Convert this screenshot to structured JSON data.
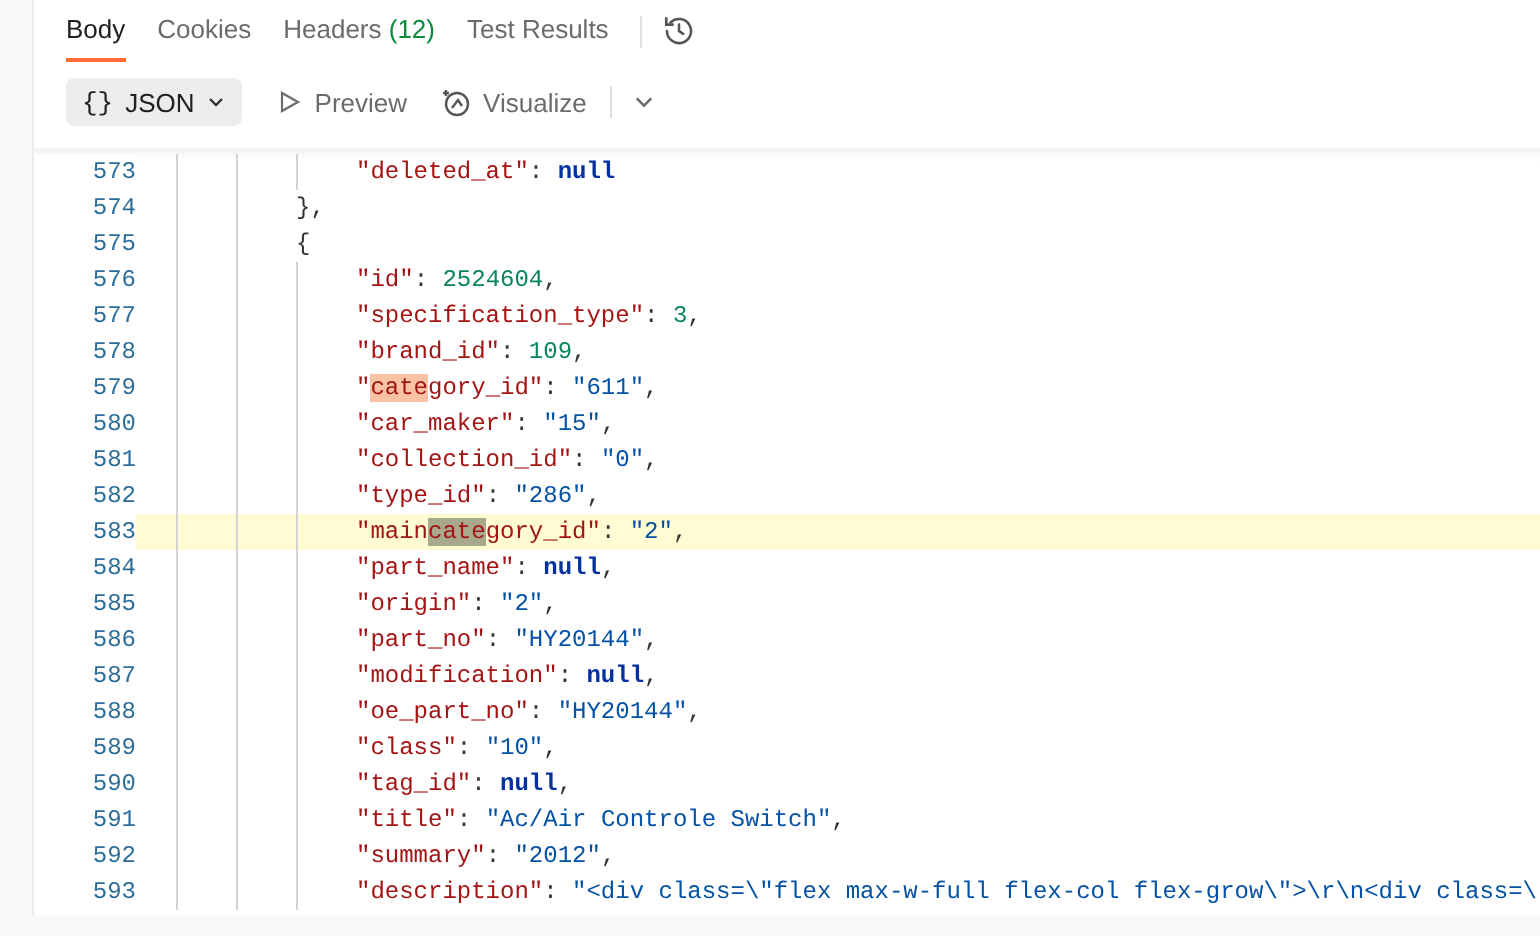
{
  "tabs": [
    {
      "label": "Body",
      "selected": true
    },
    {
      "label": "Cookies",
      "selected": false
    },
    {
      "label": "Headers",
      "count": "(12)",
      "selected": false
    },
    {
      "label": "Test Results",
      "selected": false
    }
  ],
  "toolbar": {
    "format_icon": "{}",
    "format": "JSON",
    "preview": "Preview",
    "visualize": "Visualize"
  },
  "lines": [
    {
      "number": "573",
      "kind": "member",
      "selected": false,
      "tokens": [
        {
          "kind": "key",
          "text": "\"deleted_at\""
        },
        {
          "kind": "punct",
          "text": ": "
        },
        {
          "kind": "null",
          "text": "null"
        }
      ]
    },
    {
      "number": "574",
      "kind": "bracket",
      "selected": false,
      "tokens": [
        {
          "kind": "punct",
          "text": "},"
        }
      ]
    },
    {
      "number": "575",
      "kind": "bracket",
      "selected": false,
      "tokens": [
        {
          "kind": "punct",
          "text": "{"
        }
      ]
    },
    {
      "number": "576",
      "kind": "member",
      "selected": false,
      "tokens": [
        {
          "kind": "key",
          "text": "\"id\""
        },
        {
          "kind": "punct",
          "text": ": "
        },
        {
          "kind": "number",
          "text": "2524604"
        },
        {
          "kind": "punct",
          "text": ","
        }
      ]
    },
    {
      "number": "577",
      "kind": "member",
      "selected": false,
      "tokens": [
        {
          "kind": "key",
          "text": "\"specification_type\""
        },
        {
          "kind": "punct",
          "text": ": "
        },
        {
          "kind": "number",
          "text": "3"
        },
        {
          "kind": "punct",
          "text": ","
        }
      ]
    },
    {
      "number": "578",
      "kind": "member",
      "selected": false,
      "tokens": [
        {
          "kind": "key",
          "text": "\"brand_id\""
        },
        {
          "kind": "punct",
          "text": ": "
        },
        {
          "kind": "number",
          "text": "109"
        },
        {
          "kind": "punct",
          "text": ","
        }
      ]
    },
    {
      "number": "579",
      "kind": "member",
      "selected": false,
      "tokens": [
        {
          "kind": "key",
          "text": "\""
        },
        {
          "kind": "key-match",
          "text": "cate",
          "selected": true
        },
        {
          "kind": "key",
          "text": "gory_id\""
        },
        {
          "kind": "punct",
          "text": ": "
        },
        {
          "kind": "string",
          "text": "\"611\""
        },
        {
          "kind": "punct",
          "text": ","
        }
      ]
    },
    {
      "number": "580",
      "kind": "member",
      "selected": false,
      "tokens": [
        {
          "kind": "key",
          "text": "\"car_maker\""
        },
        {
          "kind": "punct",
          "text": ": "
        },
        {
          "kind": "string",
          "text": "\"15\""
        },
        {
          "kind": "punct",
          "text": ","
        }
      ]
    },
    {
      "number": "581",
      "kind": "member",
      "selected": false,
      "tokens": [
        {
          "kind": "key",
          "text": "\"collection_id\""
        },
        {
          "kind": "punct",
          "text": ": "
        },
        {
          "kind": "string",
          "text": "\"0\""
        },
        {
          "kind": "punct",
          "text": ","
        }
      ]
    },
    {
      "number": "582",
      "kind": "member",
      "selected": false,
      "tokens": [
        {
          "kind": "key",
          "text": "\"type_id\""
        },
        {
          "kind": "punct",
          "text": ": "
        },
        {
          "kind": "string",
          "text": "\"286\""
        },
        {
          "kind": "punct",
          "text": ","
        }
      ]
    },
    {
      "number": "583",
      "kind": "member",
      "selected": true,
      "tokens": [
        {
          "kind": "key",
          "text": "\"main"
        },
        {
          "kind": "key-match",
          "text": "cate",
          "selected": false
        },
        {
          "kind": "key",
          "text": "gory_id\""
        },
        {
          "kind": "punct",
          "text": ": "
        },
        {
          "kind": "string",
          "text": "\"2\""
        },
        {
          "kind": "punct",
          "text": ","
        }
      ]
    },
    {
      "number": "584",
      "kind": "member",
      "selected": false,
      "tokens": [
        {
          "kind": "key",
          "text": "\"part_name\""
        },
        {
          "kind": "punct",
          "text": ": "
        },
        {
          "kind": "null",
          "text": "null"
        },
        {
          "kind": "punct",
          "text": ","
        }
      ]
    },
    {
      "number": "585",
      "kind": "member",
      "selected": false,
      "tokens": [
        {
          "kind": "key",
          "text": "\"origin\""
        },
        {
          "kind": "punct",
          "text": ": "
        },
        {
          "kind": "string",
          "text": "\"2\""
        },
        {
          "kind": "punct",
          "text": ","
        }
      ]
    },
    {
      "number": "586",
      "kind": "member",
      "selected": false,
      "tokens": [
        {
          "kind": "key",
          "text": "\"part_no\""
        },
        {
          "kind": "punct",
          "text": ": "
        },
        {
          "kind": "string",
          "text": "\"HY20144\""
        },
        {
          "kind": "punct",
          "text": ","
        }
      ]
    },
    {
      "number": "587",
      "kind": "member",
      "selected": false,
      "tokens": [
        {
          "kind": "key",
          "text": "\"modification\""
        },
        {
          "kind": "punct",
          "text": ": "
        },
        {
          "kind": "null",
          "text": "null"
        },
        {
          "kind": "punct",
          "text": ","
        }
      ]
    },
    {
      "number": "588",
      "kind": "member",
      "selected": false,
      "tokens": [
        {
          "kind": "key",
          "text": "\"oe_part_no\""
        },
        {
          "kind": "punct",
          "text": ": "
        },
        {
          "kind": "string",
          "text": "\"HY20144\""
        },
        {
          "kind": "punct",
          "text": ","
        }
      ]
    },
    {
      "number": "589",
      "kind": "member",
      "selected": false,
      "tokens": [
        {
          "kind": "key",
          "text": "\"class\""
        },
        {
          "kind": "punct",
          "text": ": "
        },
        {
          "kind": "string",
          "text": "\"10\""
        },
        {
          "kind": "punct",
          "text": ","
        }
      ]
    },
    {
      "number": "590",
      "kind": "member",
      "selected": false,
      "tokens": [
        {
          "kind": "key",
          "text": "\"tag_id\""
        },
        {
          "kind": "punct",
          "text": ": "
        },
        {
          "kind": "null",
          "text": "null"
        },
        {
          "kind": "punct",
          "text": ","
        }
      ]
    },
    {
      "number": "591",
      "kind": "member",
      "selected": false,
      "tokens": [
        {
          "kind": "key",
          "text": "\"title\""
        },
        {
          "kind": "punct",
          "text": ": "
        },
        {
          "kind": "string",
          "text": "\"Ac/Air Controle Switch\""
        },
        {
          "kind": "punct",
          "text": ","
        }
      ]
    },
    {
      "number": "592",
      "kind": "member",
      "selected": false,
      "tokens": [
        {
          "kind": "key",
          "text": "\"summary\""
        },
        {
          "kind": "punct",
          "text": ": "
        },
        {
          "kind": "string",
          "text": "\"2012\""
        },
        {
          "kind": "punct",
          "text": ","
        }
      ]
    },
    {
      "number": "593",
      "kind": "member",
      "selected": false,
      "tokens": [
        {
          "kind": "key",
          "text": "\"description\""
        },
        {
          "kind": "punct",
          "text": ": "
        },
        {
          "kind": "string",
          "text": "\"<div class=\\\"flex max-w-full flex-col flex-grow\\\">\\r\\n<div class=\\"
        }
      ]
    }
  ]
}
